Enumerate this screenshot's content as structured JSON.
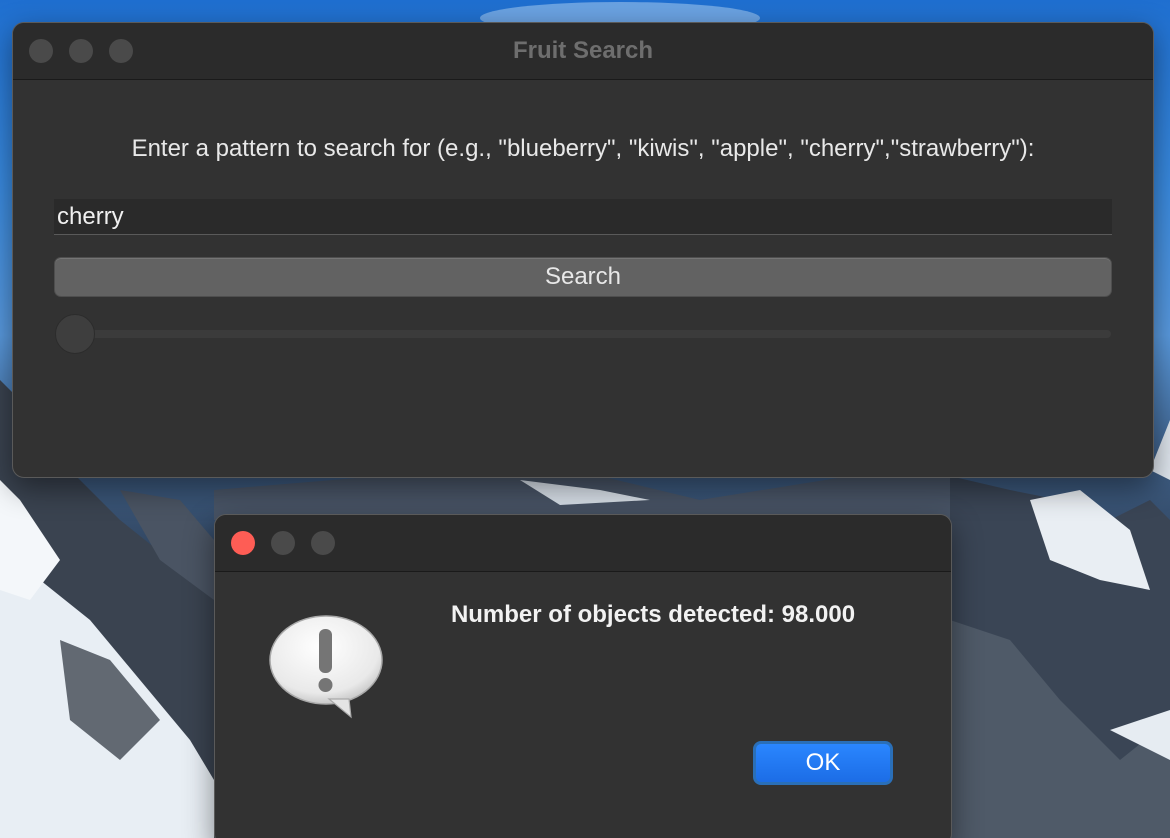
{
  "desktop": {
    "wallpaper_colors": [
      "#1f6fd0",
      "#5a9be0",
      "#2c3c52",
      "#e8eef4"
    ]
  },
  "main_window": {
    "title": "Fruit Search",
    "prompt": "Enter a pattern to search for (e.g., \"blueberry\", \"kiwis\", \"apple\", \"cherry\",\"strawberry\"):",
    "search_value": "cherry",
    "search_button_label": "Search",
    "progress": 0
  },
  "alert": {
    "message": "Number of objects detected: 98.000",
    "ok_label": "OK",
    "icon": "caution-speech-bubble-icon"
  },
  "colors": {
    "window_bg": "#323232",
    "accent": "#1c6de6",
    "close": "#fe5d55"
  }
}
